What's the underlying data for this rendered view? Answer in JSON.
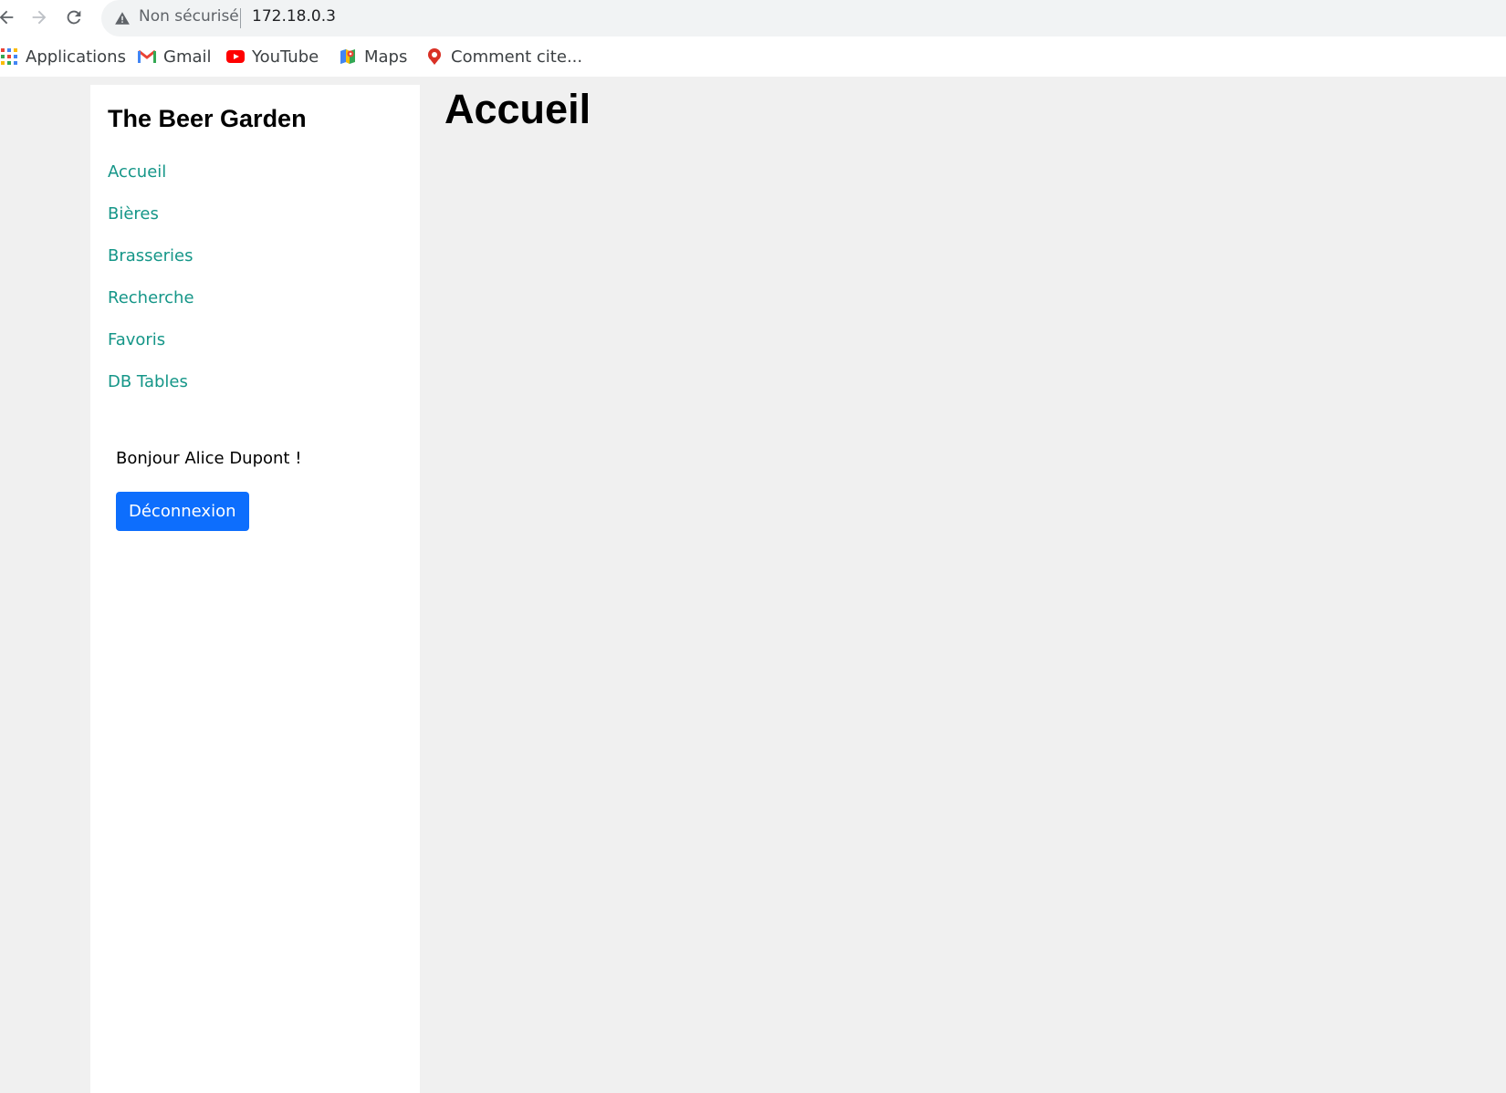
{
  "browser": {
    "security_label": "Non sécurisé",
    "url": "172.18.0.3",
    "bookmarks": [
      {
        "label": "Applications",
        "icon": "apps-grid-icon"
      },
      {
        "label": "Gmail",
        "icon": "gmail-icon"
      },
      {
        "label": "YouTube",
        "icon": "youtube-icon"
      },
      {
        "label": "Maps",
        "icon": "maps-icon"
      },
      {
        "label": "Comment cite...",
        "icon": "bookmark-site-icon"
      }
    ]
  },
  "sidebar": {
    "title": "The Beer Garden",
    "nav": [
      {
        "label": "Accueil"
      },
      {
        "label": "Bières"
      },
      {
        "label": "Brasseries"
      },
      {
        "label": "Recherche"
      },
      {
        "label": "Favoris"
      },
      {
        "label": "DB Tables"
      }
    ],
    "greeting": "Bonjour Alice Dupont !",
    "logout_label": "Déconnexion"
  },
  "main": {
    "heading": "Accueil"
  },
  "colors": {
    "link": "#159688",
    "primary_button": "#0d6efd",
    "page_background": "#f0f0f0"
  }
}
